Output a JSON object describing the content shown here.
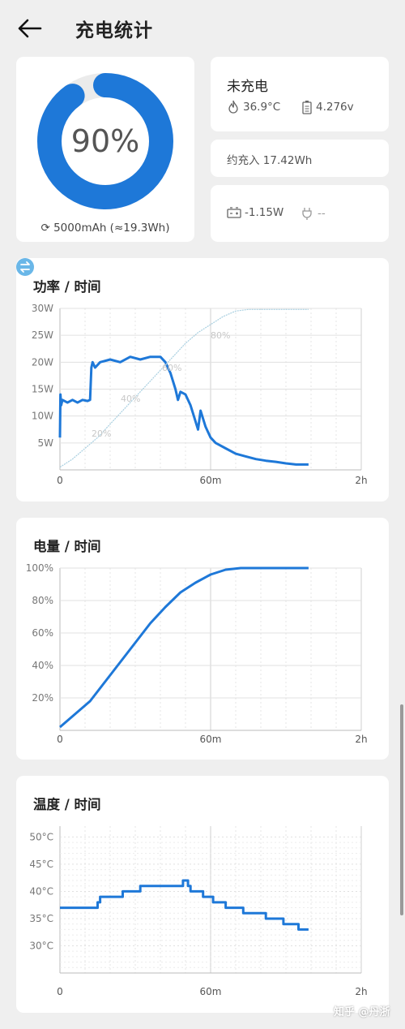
{
  "header": {
    "title": "充电统计",
    "back_icon": "arrow-left-icon"
  },
  "battery": {
    "percent": "90%",
    "level": 0.9,
    "capacity": "5000mAh (≈19.3Wh)",
    "ring_color": "#1e78d8"
  },
  "status": {
    "state": "未充电",
    "temperature": "36.9°C",
    "voltage": "4.276v"
  },
  "estimate": {
    "text": "约充入 17.42Wh"
  },
  "power_now": {
    "power": "-1.15W",
    "charger": "--"
  },
  "charts": {
    "power": {
      "title": "功率 / 时间"
    },
    "battery": {
      "title": "电量 / 时间"
    },
    "temp": {
      "title": "温度 / 时间"
    }
  },
  "watermark": "知乎 @丹浙",
  "chart_data": [
    {
      "type": "line",
      "title": "功率 / 时间",
      "x_unit": "minutes",
      "xlim": [
        0,
        120
      ],
      "ylim": [
        0,
        30
      ],
      "x_ticks": [
        "0",
        "60m",
        "2h"
      ],
      "y_ticks": [
        "30W",
        "25W",
        "20W",
        "15W",
        "10W",
        "5W"
      ],
      "series": [
        {
          "color": "#1e78d8",
          "points": [
            [
              0,
              6
            ],
            [
              0.2,
              14
            ],
            [
              0.5,
              12
            ],
            [
              1,
              13
            ],
            [
              3,
              12.5
            ],
            [
              5,
              13
            ],
            [
              7,
              12.5
            ],
            [
              9,
              13
            ],
            [
              11,
              12.8
            ],
            [
              12,
              13
            ],
            [
              12.5,
              19
            ],
            [
              13,
              20
            ],
            [
              14,
              19
            ],
            [
              16,
              20
            ],
            [
              20,
              20.5
            ],
            [
              24,
              20
            ],
            [
              28,
              21
            ],
            [
              32,
              20.5
            ],
            [
              36,
              21
            ],
            [
              40,
              21
            ],
            [
              42,
              20
            ],
            [
              44,
              18
            ],
            [
              46,
              15
            ],
            [
              47,
              13
            ],
            [
              48,
              14.5
            ],
            [
              50,
              14
            ],
            [
              52,
              12
            ],
            [
              54,
              9
            ],
            [
              55,
              7.5
            ],
            [
              56,
              11
            ],
            [
              58,
              8
            ],
            [
              60,
              6
            ],
            [
              62,
              5
            ],
            [
              66,
              4
            ],
            [
              70,
              3
            ],
            [
              74,
              2.5
            ],
            [
              78,
              2
            ],
            [
              82,
              1.7
            ],
            [
              86,
              1.5
            ],
            [
              90,
              1.2
            ],
            [
              94,
              1
            ],
            [
              99,
              1
            ]
          ]
        },
        {
          "color": "#a8cfe0",
          "points": [
            [
              0,
              0.5
            ],
            [
              5,
              2
            ],
            [
              10,
              4
            ],
            [
              15,
              6
            ],
            [
              20,
              8.5
            ],
            [
              25,
              11
            ],
            [
              30,
              13.5
            ],
            [
              35,
              16
            ],
            [
              40,
              18.5
            ],
            [
              45,
              21
            ],
            [
              50,
              23.5
            ],
            [
              55,
              25.5
            ],
            [
              60,
              27
            ],
            [
              65,
              28.5
            ],
            [
              70,
              29.5
            ],
            [
              75,
              29.8
            ],
            [
              99,
              29.8
            ]
          ]
        }
      ],
      "annotations": [
        "20%",
        "40%",
        "60%",
        "80%"
      ]
    },
    {
      "type": "line",
      "title": "电量 / 时间",
      "x_unit": "minutes",
      "xlim": [
        0,
        120
      ],
      "ylim": [
        0,
        100
      ],
      "x_ticks": [
        "0",
        "60m",
        "2h"
      ],
      "y_ticks": [
        "100%",
        "80%",
        "60%",
        "40%",
        "20%"
      ],
      "series": [
        {
          "color": "#1e78d8",
          "points": [
            [
              0,
              2
            ],
            [
              6,
              10
            ],
            [
              12,
              18
            ],
            [
              18,
              30
            ],
            [
              24,
              42
            ],
            [
              30,
              54
            ],
            [
              36,
              66
            ],
            [
              42,
              76
            ],
            [
              48,
              85
            ],
            [
              54,
              91
            ],
            [
              60,
              96
            ],
            [
              66,
              99
            ],
            [
              72,
              100
            ],
            [
              99,
              100
            ]
          ]
        }
      ]
    },
    {
      "type": "line",
      "title": "温度 / 时间",
      "x_unit": "minutes",
      "xlim": [
        0,
        120
      ],
      "ylim": [
        25,
        52
      ],
      "x_ticks": [
        "0",
        "60m",
        "2h"
      ],
      "y_ticks": [
        "50°C",
        "45°C",
        "40°C",
        "35°C",
        "30°C"
      ],
      "series": [
        {
          "color": "#1e78d8",
          "points": [
            [
              0,
              37
            ],
            [
              15,
              37
            ],
            [
              15,
              38
            ],
            [
              16,
              38
            ],
            [
              16,
              39
            ],
            [
              25,
              39
            ],
            [
              25,
              40
            ],
            [
              32,
              40
            ],
            [
              32,
              41
            ],
            [
              49,
              41
            ],
            [
              49,
              42
            ],
            [
              51,
              42
            ],
            [
              51,
              41
            ],
            [
              52,
              41
            ],
            [
              52,
              40
            ],
            [
              57,
              40
            ],
            [
              57,
              39
            ],
            [
              61,
              39
            ],
            [
              61,
              38
            ],
            [
              66,
              38
            ],
            [
              66,
              37
            ],
            [
              73,
              37
            ],
            [
              73,
              36
            ],
            [
              82,
              36
            ],
            [
              82,
              35
            ],
            [
              89,
              35
            ],
            [
              89,
              34
            ],
            [
              95,
              34
            ],
            [
              95,
              33
            ],
            [
              99,
              33
            ]
          ]
        }
      ]
    }
  ]
}
